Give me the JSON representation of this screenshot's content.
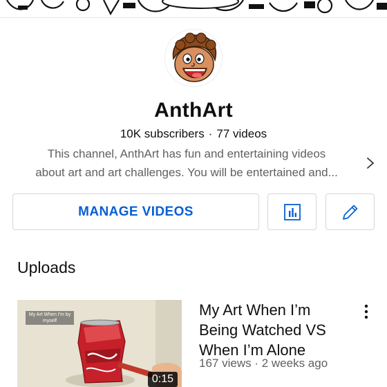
{
  "channel": {
    "name": "AnthArt",
    "subscribers": "10K subscribers",
    "separator": "·",
    "videos": "77 videos",
    "description_line1": "This channel, AnthArt has fun and entertaining videos",
    "description_line2": "about art and art challenges. You will be entertained and..."
  },
  "actions": {
    "manage_label": "MANAGE VIDEOS",
    "analytics_icon": "analytics-icon",
    "edit_icon": "pencil-icon"
  },
  "uploads": {
    "title": "Uploads",
    "videos": [
      {
        "title": "My Art When I’m Being Watched VS When I’m Alone",
        "meta": "167 views · 2 weeks ago",
        "duration": "0:15",
        "thumb_caption": "My Art When I'm by myself",
        "thumb_label": "Coca-Cola"
      }
    ]
  },
  "colors": {
    "accent": "#065fd4",
    "secondary_text": "#606060",
    "border": "#d6d6d6"
  }
}
